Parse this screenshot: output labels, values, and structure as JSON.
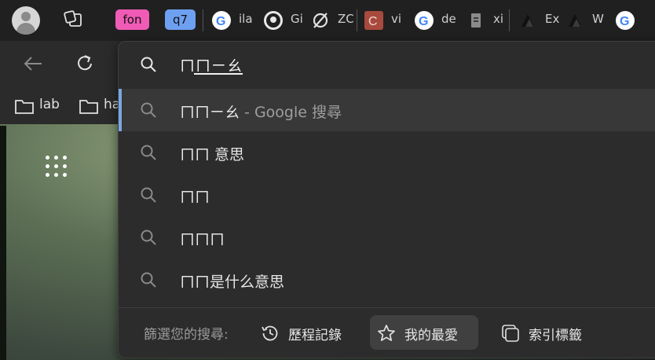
{
  "tabs": {
    "group_chips": [
      "fon",
      "q7"
    ],
    "items": [
      {
        "title": "ila",
        "icon": "google-icon"
      },
      {
        "title": "Gi",
        "icon": "github-icon"
      },
      {
        "title": "ZC",
        "icon": "slash-circle-icon"
      },
      {
        "title": "vi",
        "icon": "c-logo-icon"
      },
      {
        "title": "de",
        "icon": "google-icon"
      },
      {
        "title": "xi",
        "icon": "document-icon"
      },
      {
        "title": "Ex",
        "icon": "site-logo-icon"
      },
      {
        "title": "W",
        "icon": "site-logo-icon"
      },
      {
        "title": "",
        "icon": "google-icon"
      }
    ]
  },
  "bookmarks": [
    {
      "label": "lab",
      "icon": "folder-icon"
    },
    {
      "label": "ha",
      "icon": "folder-icon"
    }
  ],
  "omnibox": {
    "typed_text": "ㄇㄇㄧㄠ",
    "suggestions": [
      {
        "text": "ㄇㄇㄧㄠ",
        "suffix": " - Google 搜尋",
        "selected": true
      },
      {
        "text": "ㄇㄇ 意思",
        "suffix": "",
        "selected": false
      },
      {
        "text": "ㄇㄇ",
        "suffix": "",
        "selected": false
      },
      {
        "text": "ㄇㄇㄇ",
        "suffix": "",
        "selected": false
      },
      {
        "text": "ㄇㄇ是什么意思",
        "suffix": "",
        "selected": false
      }
    ],
    "filter_label": "篩選您的搜尋:",
    "filters": [
      {
        "label": "歷程記錄",
        "icon": "history-clock-icon",
        "active": false
      },
      {
        "label": "我的最愛",
        "icon": "star-icon",
        "active": true
      },
      {
        "label": "索引標籤",
        "icon": "tabs-icon",
        "active": false
      }
    ]
  },
  "colors": {
    "accent": "#7aa7e0",
    "chip_pink": "#f05bb5",
    "chip_blue": "#6ea0f2"
  }
}
